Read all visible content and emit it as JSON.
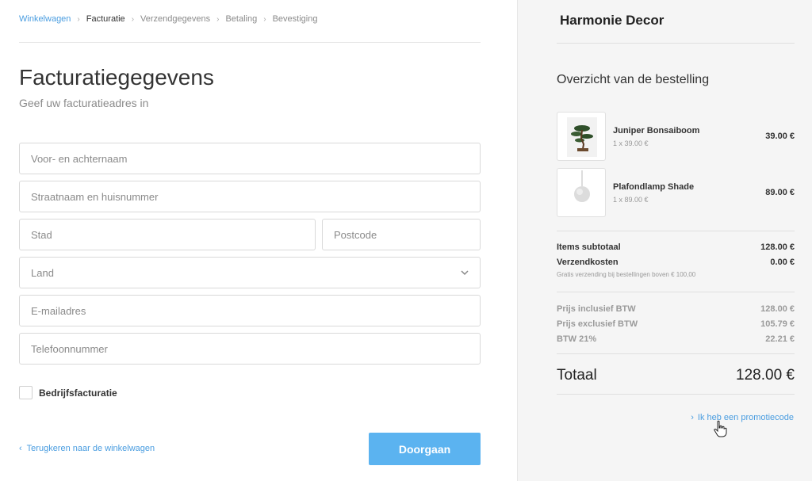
{
  "breadcrumb": [
    {
      "label": "Winkelwagen",
      "state": "link"
    },
    {
      "label": "Facturatie",
      "state": "active"
    },
    {
      "label": "Verzendgegevens",
      "state": "inactive"
    },
    {
      "label": "Betaling",
      "state": "inactive"
    },
    {
      "label": "Bevestiging",
      "state": "inactive"
    }
  ],
  "form": {
    "title": "Facturatiegegevens",
    "subtitle": "Geef uw facturatieadres in",
    "name_placeholder": "Voor- en achternaam",
    "street_placeholder": "Straatnaam en huisnummer",
    "city_placeholder": "Stad",
    "postcode_placeholder": "Postcode",
    "country_placeholder": "Land",
    "email_placeholder": "E-mailadres",
    "phone_placeholder": "Telefoonnummer",
    "company_checkbox_label": "Bedrijfsfacturatie",
    "back_link": "Terugkeren naar de winkelwagen",
    "continue_button": "Doorgaan"
  },
  "sidebar": {
    "brand": "Harmonie Decor",
    "summary_title": "Overzicht van de bestelling",
    "items": [
      {
        "name": "Juniper Bonsaiboom",
        "qty": "1 x 39.00 €",
        "price": "39.00 €",
        "icon": "bonsai-tree-icon"
      },
      {
        "name": "Plafondlamp Shade",
        "qty": "1 x 89.00 €",
        "price": "89.00 €",
        "icon": "pendant-lamp-icon"
      }
    ],
    "subtotal_label": "Items subtotaal",
    "subtotal_value": "128.00 €",
    "shipping_label": "Verzendkosten",
    "shipping_value": "0.00 €",
    "shipping_note": "Gratis verzending bij bestellingen boven € 100,00",
    "incl_vat_label": "Prijs inclusief BTW",
    "incl_vat_value": "128.00 €",
    "excl_vat_label": "Prijs exclusief BTW",
    "excl_vat_value": "105.79 €",
    "vat_label": "BTW 21%",
    "vat_value": "22.21 €",
    "total_label": "Totaal",
    "total_value": "128.00 €",
    "promo_link": "Ik heb een promotiecode"
  },
  "colors": {
    "accent": "#5bb3f0",
    "link": "#4a9de0",
    "sidebar_bg": "#f5f5f5"
  }
}
